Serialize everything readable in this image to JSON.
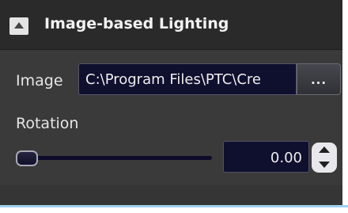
{
  "header": {
    "title": "Image-based Lighting",
    "collapse_icon": "triangle-up-icon"
  },
  "image": {
    "label": "Image",
    "path_value": "C:\\Program Files\\PTC\\Cre",
    "browse_label": "..."
  },
  "rotation": {
    "label": "Rotation",
    "value": "0.00",
    "slider_fraction": 0.0,
    "spinner_up_icon": "triangle-up-icon",
    "spinner_down_icon": "triangle-down-icon"
  },
  "colors": {
    "panel_bg": "#3a3a3a",
    "header_bg": "#2a2a2a",
    "field_bg": "#0f0f2e",
    "accent_line": "#9fd3f2"
  }
}
